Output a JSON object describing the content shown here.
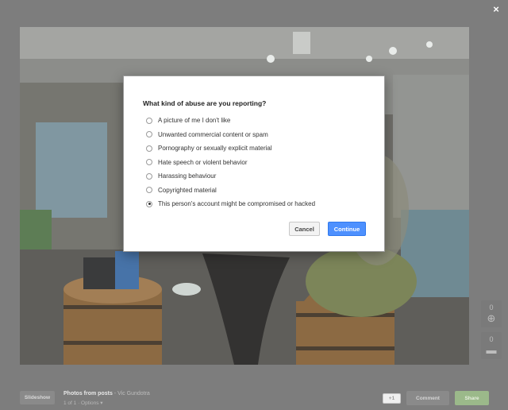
{
  "viewer": {
    "close_glyph": "×",
    "photo_description_icon": "photo-image"
  },
  "side_controls": [
    {
      "count": "0",
      "icon": "plus-circle-icon",
      "glyph": "⊕"
    },
    {
      "count": "0",
      "icon": "comment-icon",
      "glyph": "▬"
    }
  ],
  "dialog": {
    "title": "What kind of abuse are you reporting?",
    "options": [
      {
        "label": "A picture of me I don't like",
        "checked": false
      },
      {
        "label": "Unwanted commercial content or spam",
        "checked": false
      },
      {
        "label": "Pornography or sexually explicit material",
        "checked": false
      },
      {
        "label": "Hate speech or violent behavior",
        "checked": false
      },
      {
        "label": "Harassing behaviour",
        "checked": false
      },
      {
        "label": "Copyrighted material",
        "checked": false
      },
      {
        "label": "This person's account might be compromised or hacked",
        "checked": true
      }
    ],
    "cancel_label": "Cancel",
    "continue_label": "Continue"
  },
  "bottom": {
    "slideshow_label": "Slideshow",
    "album_title": "Photos from posts",
    "separator": "-",
    "author": "Vic Gundotra",
    "meta": "1 of 1 · Options ▾",
    "plusone_label": "+1",
    "comment_label": "Comment",
    "share_label": "Share"
  },
  "colors": {
    "overlay": "#7d7d7d",
    "continue_blue": "#4d90fe",
    "share_green": "#9bb98a"
  }
}
